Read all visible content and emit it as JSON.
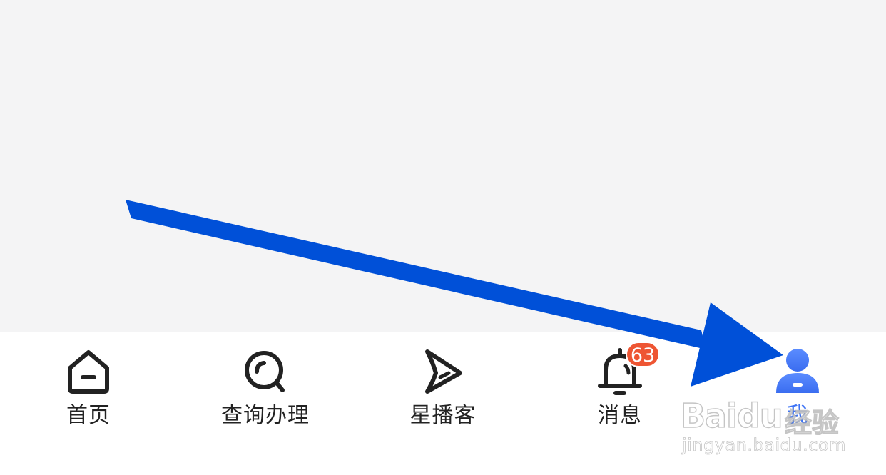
{
  "tab_bar": {
    "tabs": [
      {
        "label": "首页",
        "icon": "home-icon",
        "active": false
      },
      {
        "label": "查询办理",
        "icon": "search-icon",
        "active": false
      },
      {
        "label": "星播客",
        "icon": "play-send-icon",
        "active": false
      },
      {
        "label": "消息",
        "icon": "bell-icon",
        "active": false,
        "badge": "63"
      },
      {
        "label": "我",
        "icon": "user-icon",
        "active": true
      }
    ]
  },
  "annotation": {
    "arrow_color": "#0050d8",
    "pointing_to": "tab-me"
  },
  "watermark": {
    "brand": "Baidu",
    "product": "经验",
    "url": "jingyan.baidu.com"
  },
  "colors": {
    "content_background": "#f4f4f5",
    "tab_bar_background": "#ffffff",
    "icon_stroke": "#222222",
    "active_accent": "#3d73f5",
    "badge_background": "#ee5533"
  }
}
